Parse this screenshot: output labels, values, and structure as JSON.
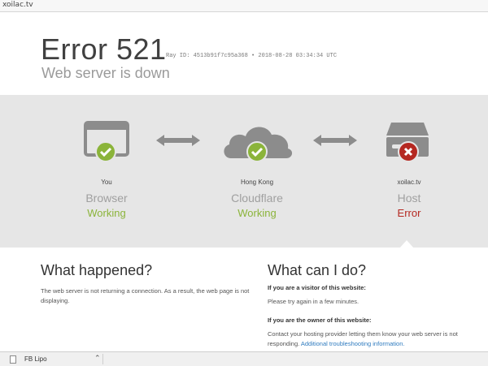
{
  "browser": {
    "url": "xoilac.tv"
  },
  "header": {
    "title": "Error 521",
    "ray": "Ray ID: 4513b91f7c95a368 • 2018-08-28 03:34:34 UTC",
    "subtitle": "Web server is down"
  },
  "status": {
    "nodes": [
      {
        "location": "You",
        "kind": "Browser",
        "state": "Working",
        "icon": "browser-icon",
        "badge": "check"
      },
      {
        "location": "Hong Kong",
        "kind": "Cloudflare",
        "state": "Working",
        "icon": "cloud-icon",
        "badge": "check"
      },
      {
        "location": "xoilac.tv",
        "kind": "Host",
        "state": "Error",
        "icon": "server-icon",
        "badge": "cross"
      }
    ]
  },
  "what_happened": {
    "heading": "What happened?",
    "body": "The web server is not returning a connection. As a result, the web page is not displaying."
  },
  "what_can_i_do": {
    "heading": "What can I do?",
    "visitor_label": "If you are a visitor of this website:",
    "visitor_text": "Please try again in a few minutes.",
    "owner_label": "If you are the owner of this website:",
    "owner_text": "Contact your hosting provider letting them know your web server is not responding.",
    "owner_link": "Additional troubleshooting information."
  },
  "download_bar": {
    "file_name": "FB Lipo"
  },
  "colors": {
    "ok": "#8bb43a",
    "error": "#b52821",
    "icon_gray": "#8c8c8c",
    "band": "#e6e6e6"
  }
}
